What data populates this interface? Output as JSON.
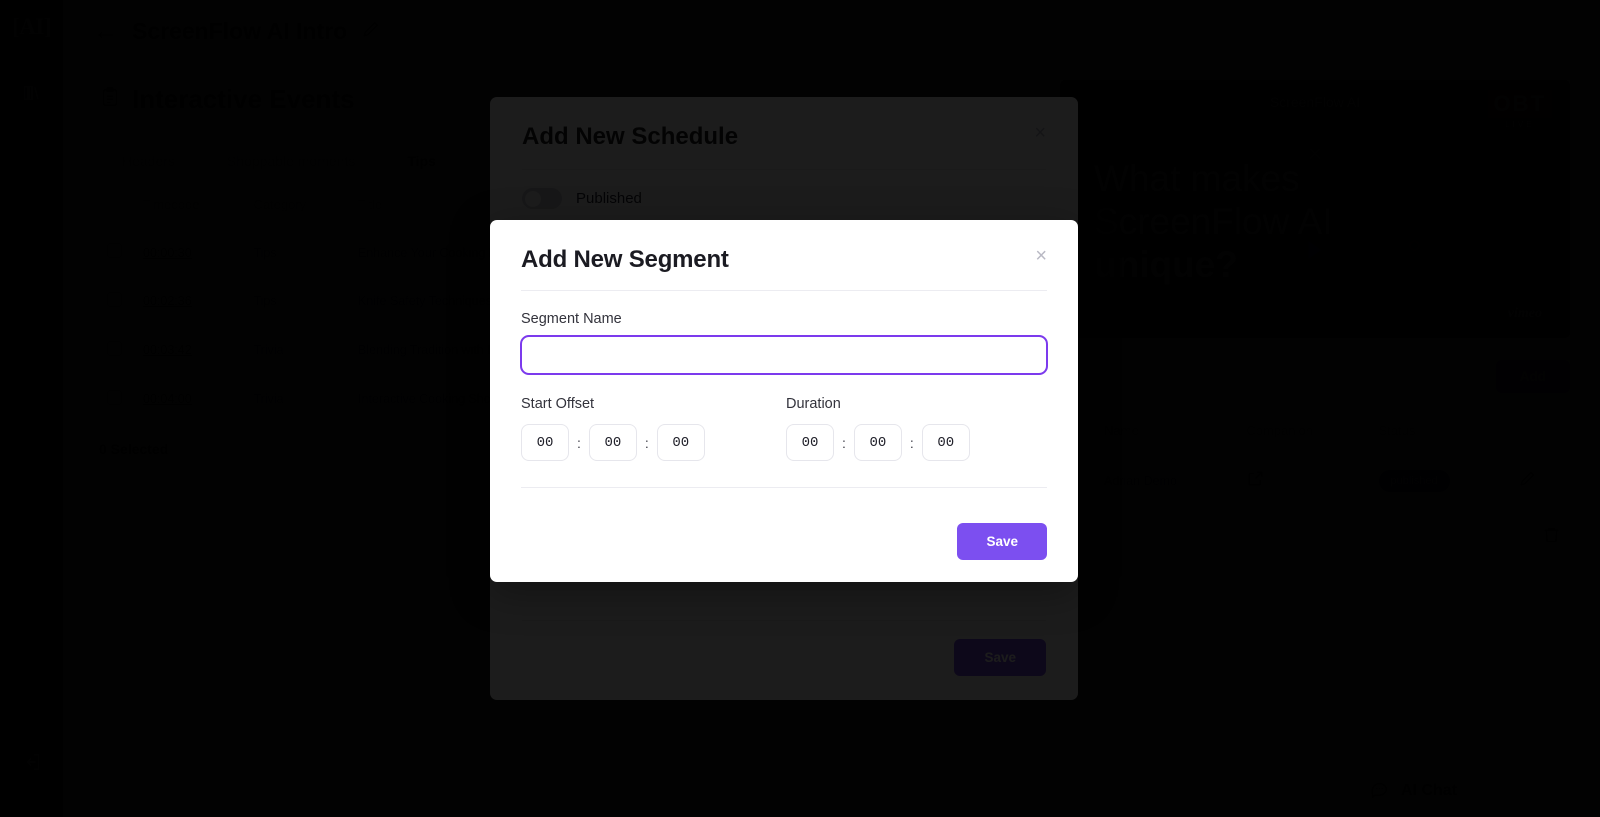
{
  "colors": {
    "accent_purple": "#7c4ff0",
    "focus_ring": "#7c3aed",
    "badge_bg": "#2a1a6e",
    "sidebar_bg": "#17171a",
    "obt_red": "#b8121c"
  },
  "sidebar": {
    "logo": "[AI]",
    "items": [
      {
        "name": "library-icon",
        "label": "Library"
      }
    ],
    "logout_label": "Logout"
  },
  "topbar": {
    "back_label": "Back",
    "title": "ScreenFlow AI Intro",
    "edit_label": "Rename"
  },
  "events_section": {
    "heading": "Interactive Events",
    "tabs": [
      {
        "label": "Headers",
        "active": false
      },
      {
        "label": "Shoppable moments",
        "active": false
      },
      {
        "label": "Tips",
        "active": true
      }
    ],
    "columns": [
      "Timecode",
      "Category",
      "Title",
      "Content"
    ],
    "rows": [
      {
        "timecode": "00:00:30",
        "category": "Tips",
        "title": "Enhance Your Cooking Experience",
        "content": "Use QR codes to access participant"
      },
      {
        "timecode": "00:02:36",
        "category": "Tips",
        "title": "Knife Safety Techniques",
        "content": "Remember proper care to"
      },
      {
        "timecode": "00:03:42",
        "category": "Trivia",
        "title": "Blending Tradition with Innovation",
        "content": "The combination of cooking with modern"
      },
      {
        "timecode": "00:04:00",
        "category": "Trivia",
        "title": "Interactive Cooking Shows",
        "content": "Did you know technology can transform"
      }
    ],
    "selected_text": "0 Selected"
  },
  "player": {
    "title": "ScreenFlow AI",
    "logo_main": "OBT",
    "logo_sub": "LIVE",
    "headline_line1": "What makes",
    "headline_line2": "ScreenFlow AI",
    "headline_line3": "unique?",
    "provider": "vimeo"
  },
  "schedule_table": {
    "add_button": "Add",
    "columns": [
      "Name",
      "Companion",
      "Status"
    ],
    "rows": [
      {
        "id": "4",
        "name": "Adrian Demo",
        "companion_icon": "external-link-icon",
        "status": "published"
      }
    ]
  },
  "ai_chat": {
    "label": "AI Chat",
    "icon": "chat-bubble-icon"
  },
  "modal_schedule": {
    "title": "Add New Schedule",
    "close_label": "×",
    "published_label": "Published",
    "published_on": false,
    "save_label": "Save"
  },
  "modal_segment": {
    "title": "Add New Segment",
    "close_label": "×",
    "segment_name_label": "Segment Name",
    "segment_name_value": "",
    "segment_name_placeholder": "",
    "start_offset_label": "Start Offset",
    "start_offset": {
      "hours": "00",
      "minutes": "00",
      "seconds": "00"
    },
    "duration_label": "Duration",
    "duration": {
      "hours": "00",
      "minutes": "00",
      "seconds": "00"
    },
    "separator": ":",
    "save_label": "Save"
  }
}
